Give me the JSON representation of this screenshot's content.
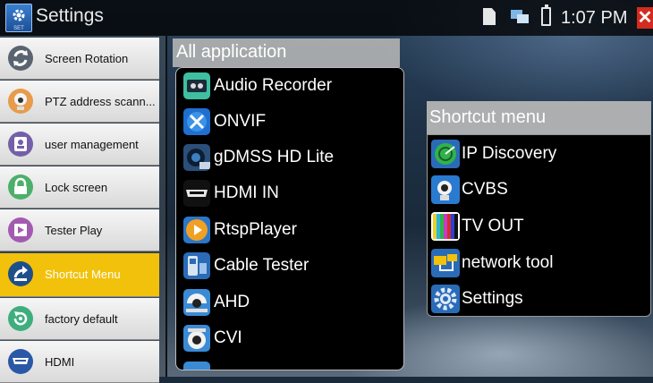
{
  "status_bar": {
    "title": "Settings",
    "app_icon_caption": "SET",
    "time": "1:07 PM",
    "icons": [
      "sd-card-icon",
      "network-icon",
      "battery-icon",
      "close-icon"
    ]
  },
  "left_menu": {
    "items": [
      {
        "label": "Screen Rotation",
        "icon": "rotation-icon",
        "active": false
      },
      {
        "label": "PTZ address scann...",
        "icon": "ptz-camera-icon",
        "active": false
      },
      {
        "label": "user management",
        "icon": "user-management-icon",
        "active": false
      },
      {
        "label": "Lock screen",
        "icon": "lock-icon",
        "active": false
      },
      {
        "label": "Tester Play",
        "icon": "play-icon",
        "active": false
      },
      {
        "label": "Shortcut Menu",
        "icon": "shortcut-icon",
        "active": true
      },
      {
        "label": "factory default",
        "icon": "reset-icon",
        "active": false
      },
      {
        "label": "HDMI",
        "icon": "hdmi-icon",
        "active": false
      }
    ]
  },
  "all_applications": {
    "header": "All application",
    "items": [
      {
        "label": "Audio Recorder",
        "icon": "audio-recorder-icon"
      },
      {
        "label": "ONVIF",
        "icon": "onvif-icon"
      },
      {
        "label": "gDMSS HD Lite",
        "icon": "gdmss-icon"
      },
      {
        "label": "HDMI IN",
        "icon": "hdmi-in-icon"
      },
      {
        "label": "RtspPlayer",
        "icon": "rtsp-player-icon"
      },
      {
        "label": "Cable Tester",
        "icon": "cable-tester-icon"
      },
      {
        "label": "AHD",
        "icon": "ahd-camera-icon"
      },
      {
        "label": "CVI",
        "icon": "cvi-camera-icon"
      }
    ]
  },
  "shortcut_menu": {
    "header": "Shortcut menu",
    "items": [
      {
        "label": "IP Discovery",
        "icon": "ip-discovery-icon"
      },
      {
        "label": "CVBS",
        "icon": "cvbs-camera-icon"
      },
      {
        "label": "TV OUT",
        "icon": "tv-out-icon"
      },
      {
        "label": "network tool",
        "icon": "network-tool-icon"
      },
      {
        "label": "Settings",
        "icon": "settings-gear-icon"
      }
    ]
  },
  "colors": {
    "active_menu": "#f2c10b",
    "close_button": "#d42b1f",
    "panel_header": "#b9b9b9"
  }
}
